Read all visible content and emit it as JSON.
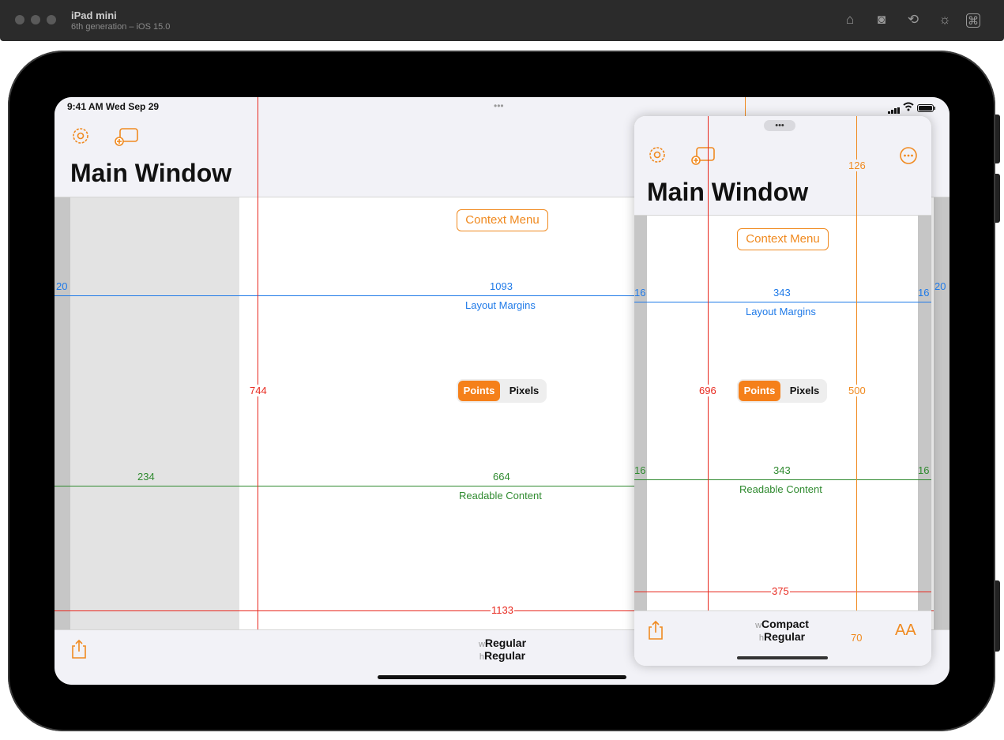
{
  "simulator": {
    "device_name": "iPad mini",
    "device_subtitle": "6th generation – iOS 15.0",
    "toolbar_icons": [
      "home-icon",
      "screenshot-icon",
      "rotate-icon",
      "brightness-icon",
      "shortcuts-icon"
    ]
  },
  "status_bar": {
    "time_date": "9:41 AM  Wed Sep 29",
    "dots": "•••"
  },
  "main_window": {
    "title": "Main Window",
    "context_menu_label": "Context Menu",
    "segment": {
      "selected": "Points",
      "other": "Pixels"
    },
    "layout_margin_left": "20",
    "layout_margin_width": "1093",
    "layout_margins_label": "Layout Margins",
    "readable_left": "234",
    "readable_width": "664",
    "readable_label": "Readable Content",
    "height_value": "744",
    "width_value": "1133",
    "size_class_w_prefix": "w",
    "size_class_w": "Regular",
    "size_class_h_prefix": "h",
    "size_class_h": "Regular"
  },
  "slide_over": {
    "grabber": "•••",
    "title": "Main Window",
    "context_menu_label": "Context Menu",
    "segment": {
      "selected": "Points",
      "other": "Pixels"
    },
    "layout_margin_left": "16",
    "layout_margin_width": "343",
    "layout_margin_right": "16",
    "layout_margin_outer": "20",
    "layout_margins_label": "Layout Margins",
    "readable_left": "16",
    "readable_width": "343",
    "readable_right": "16",
    "readable_label": "Readable Content",
    "height_value": "696",
    "safe_top_value": "126",
    "content_height_value": "500",
    "bottom_bar_value": "70",
    "width_value": "375",
    "size_class_w_prefix": "w",
    "size_class_w": "Compact",
    "size_class_h_prefix": "h",
    "size_class_h": "Regular",
    "text_size_label": "AA"
  },
  "colors": {
    "accent": "#f08a20",
    "layout_margins": "#1f7ae8",
    "readable_content": "#2f8a2f",
    "bounds": "#e8281e"
  }
}
